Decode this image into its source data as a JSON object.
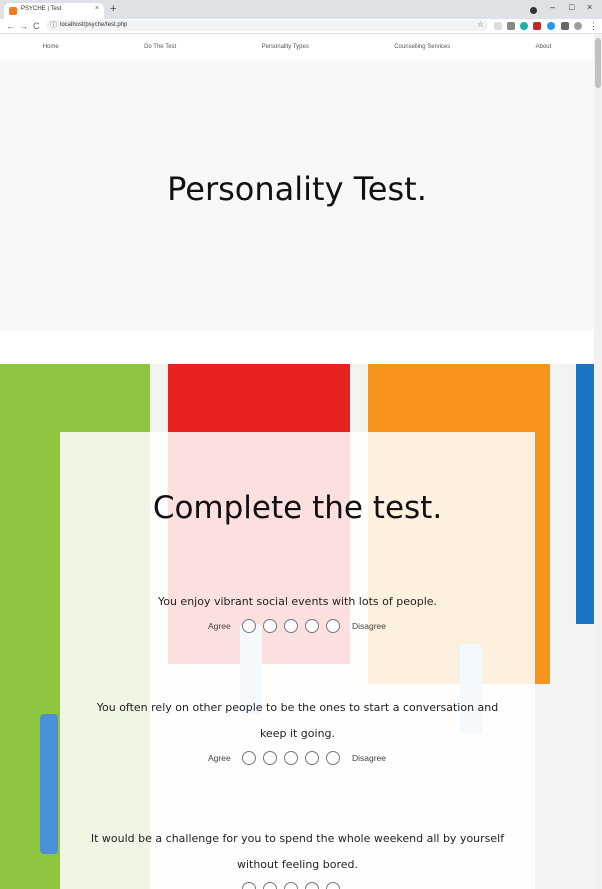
{
  "browser": {
    "tab_title": "PSYCHE | Test",
    "tab_close": "×",
    "new_tab": "+",
    "url": "localhost/psyche/test.php",
    "back": "←",
    "forward": "→",
    "reload": "C",
    "info": "ⓘ",
    "star": "☆",
    "minimize": "–",
    "maximize": "□",
    "close": "×",
    "menu": "⋮"
  },
  "nav": {
    "items": [
      "Home",
      "Do The Test",
      "Personality Types",
      "Counselling Services",
      "About"
    ]
  },
  "hero": {
    "title": "Personality Test."
  },
  "test": {
    "heading": "Complete the test.",
    "agree_label": "Agree",
    "disagree_label": "Disagree",
    "questions": [
      "You enjoy vibrant social events with lots of people.",
      "You often rely on other people to be the ones to start a conversation and keep it going.",
      "It would be a challenge for you to spend the whole weekend all by yourself without feeling bored."
    ]
  },
  "colors": {
    "paint_green": "#8cc63f",
    "paint_red": "#e8231f",
    "paint_orange": "#f7941d",
    "paint_blue": "#1a73c7"
  }
}
